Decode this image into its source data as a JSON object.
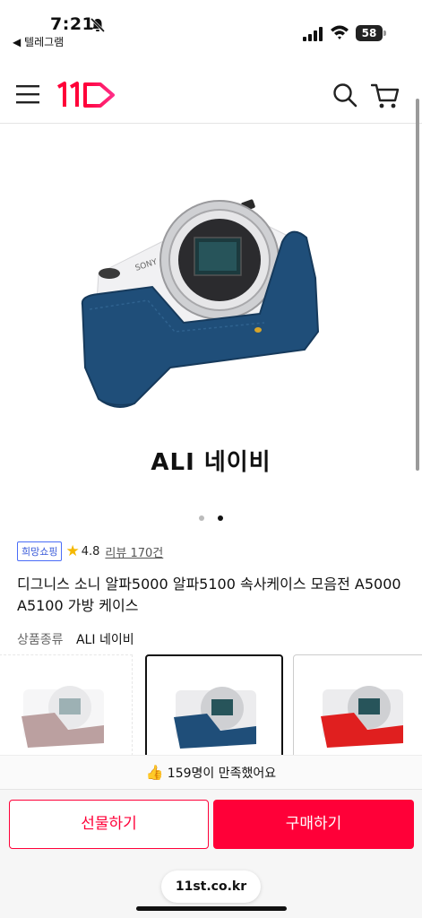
{
  "status_bar": {
    "time": "7:21",
    "back_app": "◀ 텔레그램",
    "battery": "58"
  },
  "header": {
    "logo_text": "11",
    "brand_color": "#ff0038"
  },
  "gallery": {
    "caption": "ALI 네이비",
    "dot_count": 2,
    "active_dot": 1
  },
  "product": {
    "badge": "희망쇼핑",
    "rating": "4.8",
    "review_text": "리뷰 170건",
    "title": "디그니스 소니 알파5000 알파5100 속사케이스 모음전 A5000 A5100 가방 케이스",
    "option_label": "상품종류",
    "option_value": "ALI 네이비"
  },
  "thumbnails": [
    {
      "name": "brown",
      "color": "#6b2f2f"
    },
    {
      "name": "navy",
      "color": "#1f4e79"
    },
    {
      "name": "red",
      "color": "#e01f1f"
    }
  ],
  "satisfaction": {
    "text": "159명이 만족했어요"
  },
  "actions": {
    "gift_label": "선물하기",
    "buy_label": "구매하기"
  },
  "browser": {
    "url": "11st.co.kr"
  }
}
